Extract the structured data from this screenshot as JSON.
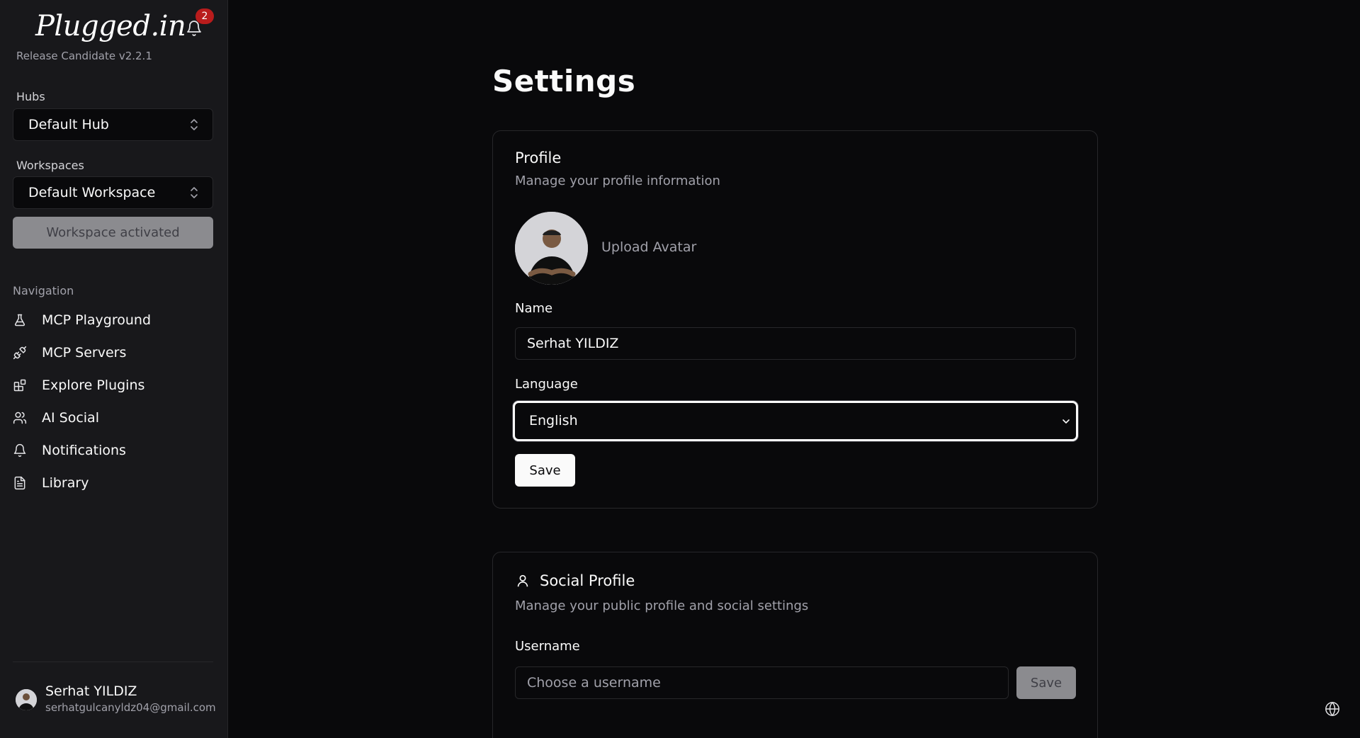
{
  "sidebar": {
    "brand": "Plugged.in",
    "notification_count": "2",
    "version": "Release Candidate v2.2.1",
    "hubs_label": "Hubs",
    "hub_selected": "Default Hub",
    "workspaces_label": "Workspaces",
    "workspace_selected": "Default Workspace",
    "workspace_status": "Workspace activated",
    "navigation_label": "Navigation",
    "nav": [
      {
        "label": "MCP Playground",
        "icon": "flask-icon"
      },
      {
        "label": "MCP Servers",
        "icon": "plug-icon"
      },
      {
        "label": "Explore Plugins",
        "icon": "blocks-icon"
      },
      {
        "label": "AI Social",
        "icon": "users-icon"
      },
      {
        "label": "Notifications",
        "icon": "bell-icon"
      },
      {
        "label": "Library",
        "icon": "file-icon"
      }
    ],
    "user": {
      "name": "Serhat YILDIZ",
      "email": "serhatgulcanyldz04@gmail.com"
    }
  },
  "main": {
    "title": "Settings",
    "profile": {
      "title": "Profile",
      "description": "Manage your profile information",
      "upload_avatar": "Upload Avatar",
      "name_label": "Name",
      "name_value": "Serhat YILDIZ",
      "language_label": "Language",
      "language_value": "English",
      "save_label": "Save"
    },
    "social": {
      "title": "Social Profile",
      "description": "Manage your public profile and social settings",
      "username_label": "Username",
      "username_placeholder": "Choose a username",
      "save_label": "Save"
    }
  },
  "colors": {
    "background": "#09090b",
    "sidebar": "#18181b",
    "badge": "#b91c1c",
    "border": "#27272a"
  }
}
